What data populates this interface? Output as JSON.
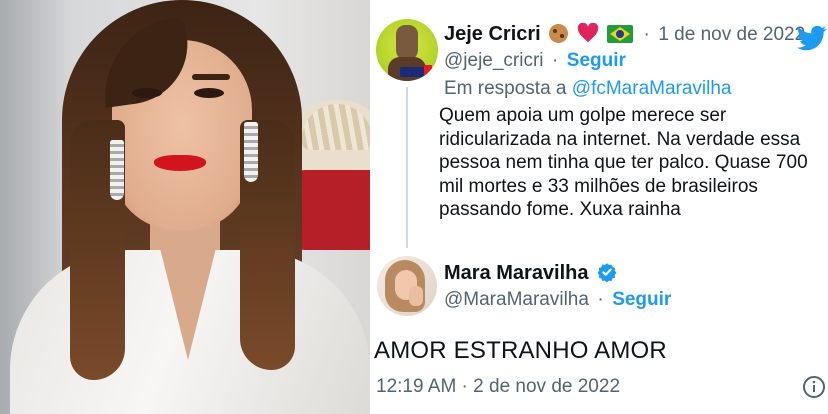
{
  "tweet": {
    "author": {
      "name": "Jeje Cricri",
      "handle": "@jeje_cricri",
      "date": "1 de nov de 2022",
      "follow_label": "Seguir",
      "separator": "·"
    },
    "reply_to": {
      "prefix": "Em resposta a",
      "target": "@fcMaraMaravilha"
    },
    "body_lines": [
      "Quem apoia um golpe merece ser",
      "ridicularizada na internet. Na verdade essa",
      "pessoa nem tinha que ter palco. Quase 700",
      "mil mortes e 33 milhões de brasileiros",
      "passando fome. Xuxa rainha"
    ],
    "emoji_icons": [
      "cookie-icon",
      "heart-icon",
      "brazil-flag-icon"
    ]
  },
  "reply": {
    "author": {
      "name": "Mara Maravilha",
      "handle": "@MaraMaravilha",
      "follow_label": "Seguir",
      "separator": "·",
      "verified": true
    },
    "text": "AMOR ESTRANHO AMOR",
    "timestamp": "12:19 AM · 2 de nov de 2022"
  },
  "colors": {
    "link_blue": "#1d9bf0",
    "secondary_text": "#536471",
    "primary_text": "#0f1419",
    "heart_red": "#e0245e"
  },
  "icons": {
    "brand": "twitter-bird-icon",
    "verified": "verified-badge-icon",
    "info": "info-icon"
  }
}
